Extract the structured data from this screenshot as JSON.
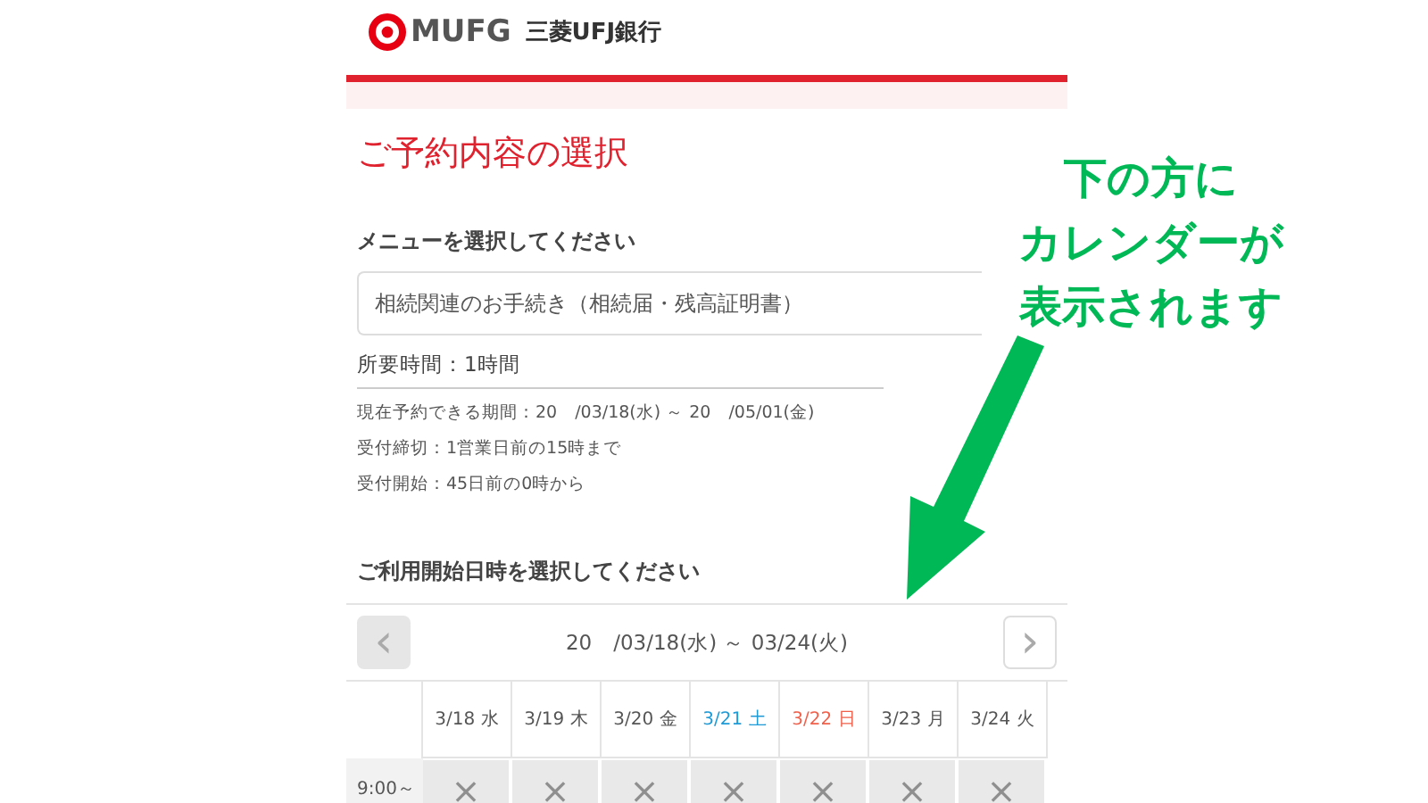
{
  "header": {
    "logo": "MUFG",
    "bank_name": "三菱UFJ銀行"
  },
  "title": "ご予約内容の選択",
  "menu": {
    "label": "メニューを選択してください",
    "value": "相続関連のお手続き（相続届・残高証明書）"
  },
  "duration": "所要時間：1時間",
  "info": [
    "現在予約できる期間：20　/03/18(水) ～ 20　/05/01(金)",
    "受付締切：1営業日前の15時まで",
    "受付開始：45日前の0時から"
  ],
  "calendar": {
    "label": "ご利用開始日時を選択してください",
    "range": "20　/03/18(水) ～ 03/24(火)",
    "prev": {
      "glyph": "‹",
      "disabled": true
    },
    "next": {
      "glyph": "›",
      "disabled": false
    },
    "days": [
      {
        "label": "3/18 水",
        "kind": "weekday"
      },
      {
        "label": "3/19 木",
        "kind": "weekday"
      },
      {
        "label": "3/20 金",
        "kind": "weekday"
      },
      {
        "label": "3/21 土",
        "kind": "saturday"
      },
      {
        "label": "3/22 日",
        "kind": "holiday"
      },
      {
        "label": "3/23 月",
        "kind": "weekday"
      },
      {
        "label": "3/24 火",
        "kind": "weekday"
      }
    ],
    "rows": [
      {
        "time": "9:00～",
        "slots": [
          {
            "mark": "×",
            "available": false
          },
          {
            "mark": "×",
            "available": false
          },
          {
            "mark": "×",
            "available": false
          },
          {
            "mark": "×",
            "available": false
          },
          {
            "mark": "×",
            "available": false
          },
          {
            "mark": "×",
            "available": false
          },
          {
            "mark": "×",
            "available": false
          }
        ]
      }
    ]
  },
  "annotation": {
    "lines": [
      "下の方に",
      "カレンダーが",
      "表示されます"
    ]
  }
}
